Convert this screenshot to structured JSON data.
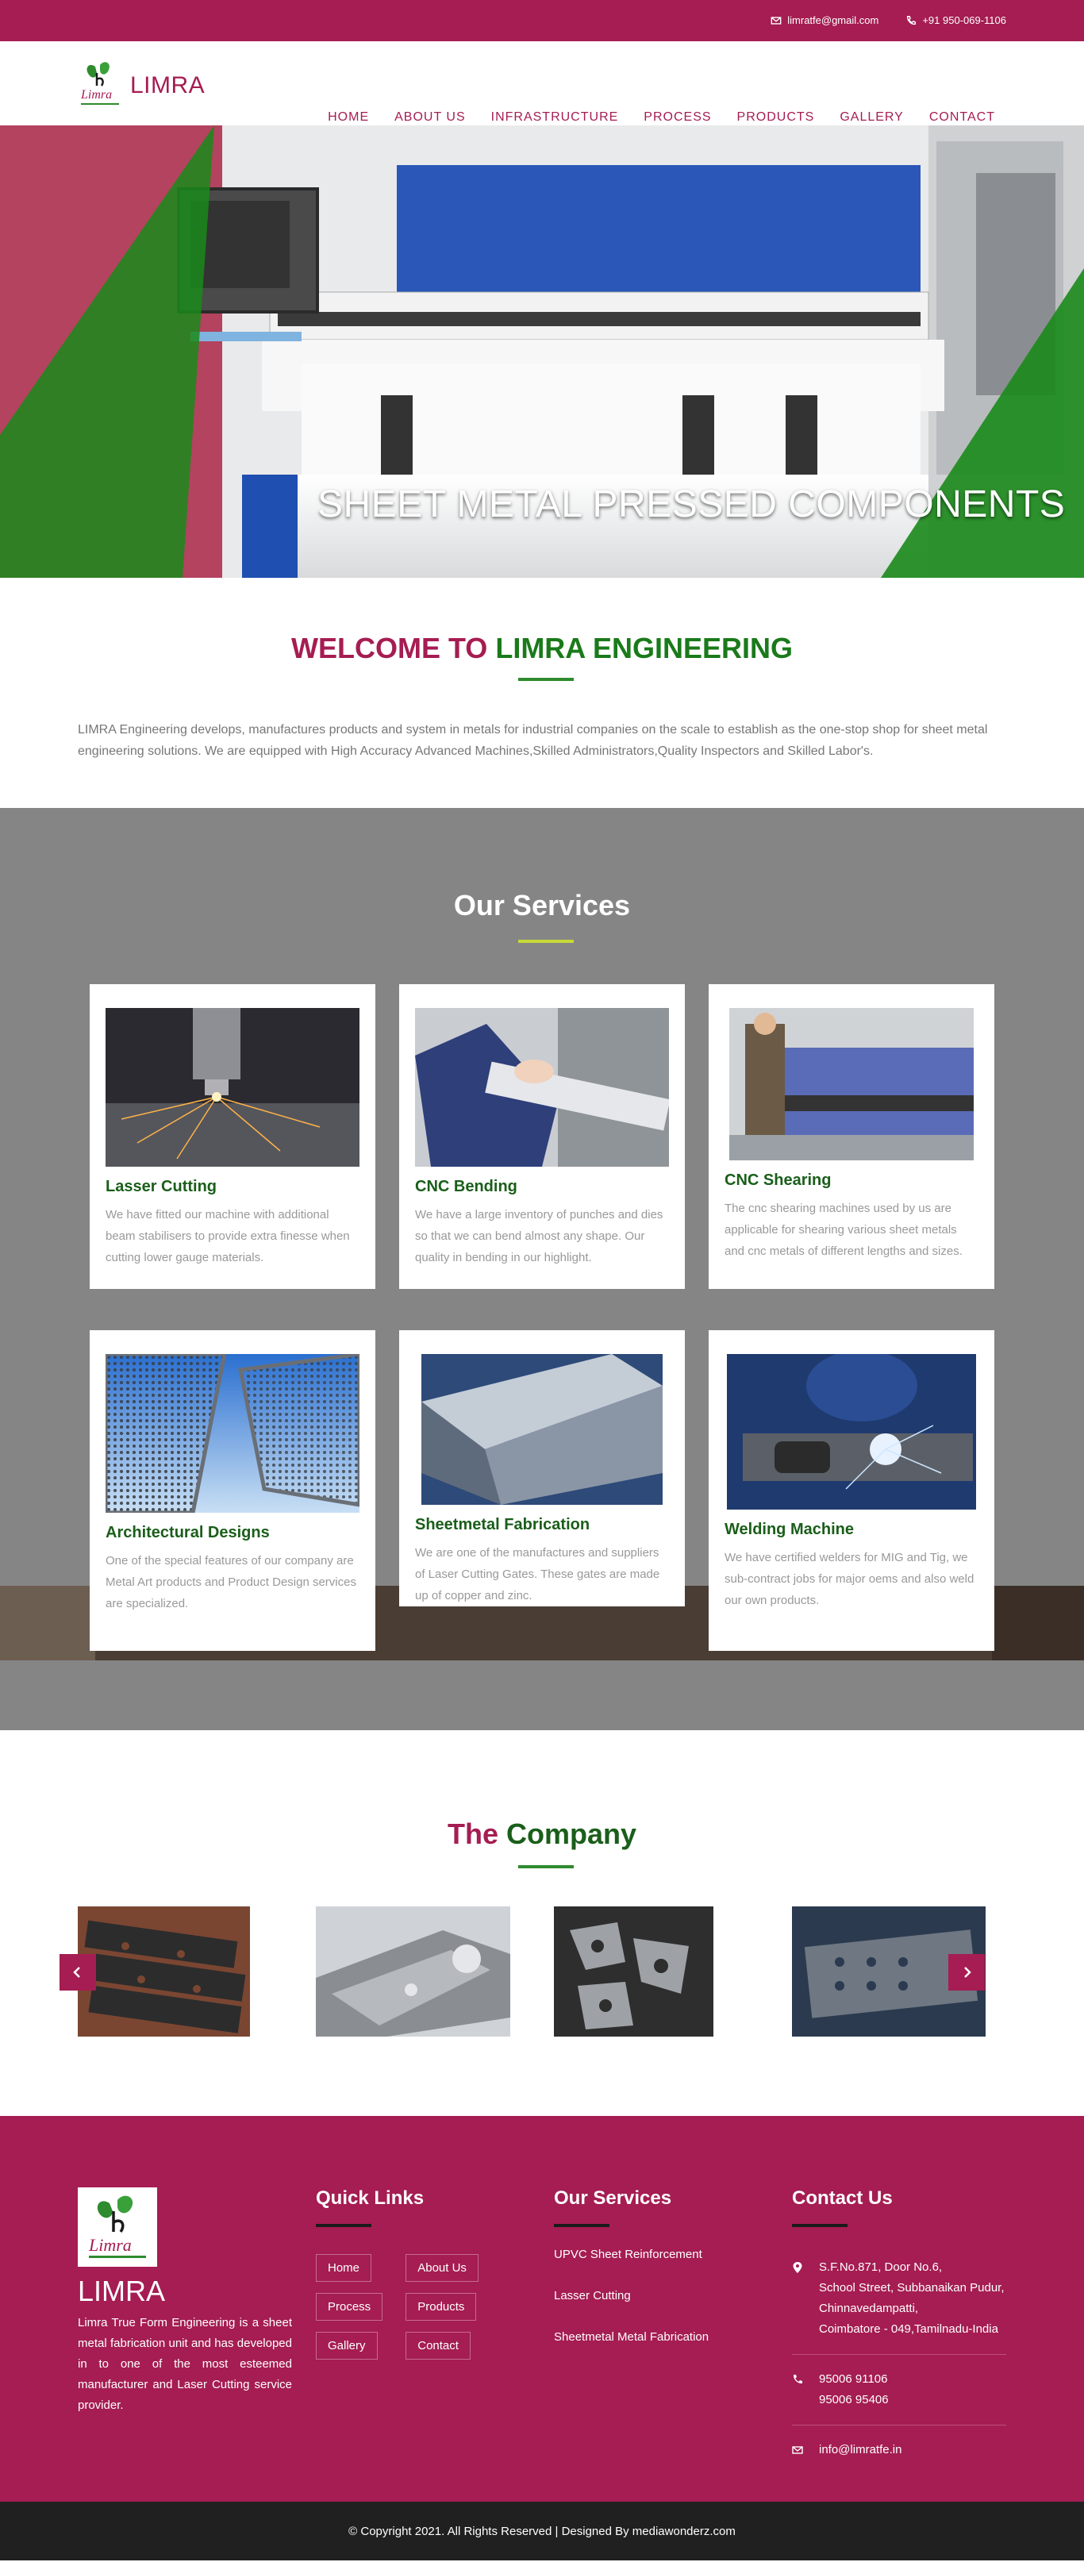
{
  "topbar": {
    "email": "limratfe@gmail.com",
    "phone": "+91 950-069-1106"
  },
  "header": {
    "brand": "LIMRA",
    "nav": [
      "HOME",
      "ABOUT US",
      "INFRASTRUCTURE",
      "PROCESS",
      "PRODUCTS",
      "GALLERY",
      "CONTACT"
    ]
  },
  "hero": {
    "title": "SHEET METAL PRESSED COMPONENTS"
  },
  "welcome": {
    "title_a": "WELCOME TO",
    "title_b": "LIMRA ENGINEERING",
    "text": "LIMRA Engineering develops, manufactures products and system in metals for industrial companies on the scale to establish as the one-stop shop for sheet metal engineering solutions. We are equipped with High Accuracy Advanced Machines,Skilled Administrators,Quality Inspectors and Skilled Labor's."
  },
  "services": {
    "title": "Our Services",
    "cards": [
      {
        "title": "Lasser Cutting",
        "text": "We have fitted our machine with additional beam stabilisers to provide extra finesse when cutting lower gauge materials."
      },
      {
        "title": "CNC Bending",
        "text": "We have a large inventory of punches and dies so that we can bend almost any shape. Our quality in bending in our highlight."
      },
      {
        "title": "CNC Shearing",
        "text": "The cnc shearing machines used by us are applicable for shearing various sheet metals and cnc metals of different lengths and sizes."
      },
      {
        "title": "Architectural Designs",
        "text": "One of the special features of our company are Metal Art products and Product Design services are specialized."
      },
      {
        "title": "Sheetmetal Fabrication",
        "text": "We are one of the manufactures and suppliers of Laser Cutting Gates. These gates are made up of copper and zinc."
      },
      {
        "title": "Welding Machine",
        "text": "We have certified welders for MIG and Tig, we sub-contract jobs for major oems and also weld our own products."
      }
    ]
  },
  "company": {
    "title_a": "The",
    "title_b": "Company"
  },
  "footer": {
    "brand": "LIMRA",
    "about": "Limra True Form Engineering is a sheet metal fabrication unit and has developed in to one of the most esteemed manufacturer and Laser Cutting service provider.",
    "quick_title": "Quick Links",
    "quick_links": [
      "Home",
      "About Us",
      "Process",
      "Products",
      "Gallery",
      "Contact"
    ],
    "services_title": "Our Services",
    "services": [
      "UPVC Sheet Reinforcement",
      "Lasser Cutting",
      "Sheetmetal Metal Fabrication"
    ],
    "contact_title": "Contact Us",
    "address": [
      "S.F.No.871, Door No.6,",
      "School Street, Subbanaikan Pudur,",
      "Chinnavedampatti,",
      "Coimbatore - 049,Tamilnadu-India"
    ],
    "phones": [
      "95006 91106",
      "95006 95406"
    ],
    "email": "info@limratfe.in"
  },
  "copyright": "© Copyright 2021. All Rights Reserved | Designed By mediawonderz.com",
  "colors": {
    "brand": "#a51d52",
    "green": "#1a7a1a",
    "services_bg": "#858585"
  }
}
